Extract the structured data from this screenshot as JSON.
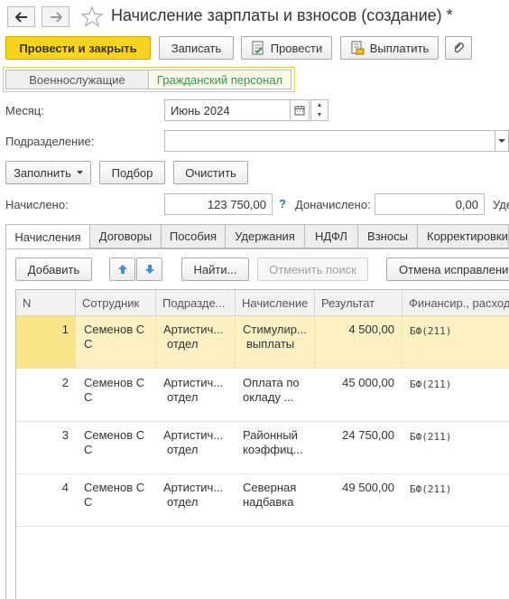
{
  "header": {
    "title": "Начисление зарплаты и взносов (создание) *"
  },
  "toolbar": {
    "post_close": "Провести и закрыть",
    "save": "Записать",
    "post": "Провести",
    "pay": "Выплатить"
  },
  "switcher": {
    "military": "Военнослужащие",
    "civil": "Гражданский персонал"
  },
  "form": {
    "month_label": "Месяц:",
    "month_value": "Июнь 2024",
    "department_label": "Подразделение:",
    "department_value": "",
    "fill_btn": "Заполнить",
    "select_btn": "Подбор",
    "clear_btn": "Очистить",
    "accrued_label": "Начислено:",
    "accrued_value": "123 750,00",
    "help_mark": "?",
    "additional_label": "Доначислено:",
    "additional_value": "0,00",
    "withheld_label": "Уде"
  },
  "tabs": [
    {
      "label": "Начисления"
    },
    {
      "label": "Договоры"
    },
    {
      "label": "Пособия"
    },
    {
      "label": "Удержания"
    },
    {
      "label": "НДФЛ"
    },
    {
      "label": "Взносы"
    },
    {
      "label": "Корректировки"
    }
  ],
  "table_toolbar": {
    "add": "Добавить",
    "find": "Найти...",
    "cancel_search": "Отменить поиск",
    "cancel_fix": "Отмена исправлений"
  },
  "table": {
    "columns": [
      "N",
      "Сотрудник",
      "Подразде...",
      "Начисление",
      "Результат",
      "Финансир., расход"
    ],
    "rows": [
      {
        "n": "1",
        "employee": [
          "Семенов С",
          "С"
        ],
        "dept": [
          "Артистич...",
          "отдел"
        ],
        "accrual": [
          "Стимулир...",
          "выплаты"
        ],
        "result": "4 500,00",
        "finance": "БФ(211)"
      },
      {
        "n": "2",
        "employee": [
          "Семенов С",
          "С"
        ],
        "dept": [
          "Артистич...",
          "отдел"
        ],
        "accrual": [
          "Оплата по",
          "окладу ..."
        ],
        "result": "45 000,00",
        "finance": "БФ(211)"
      },
      {
        "n": "3",
        "employee": [
          "Семенов С",
          "С"
        ],
        "dept": [
          "Артистич...",
          "отдел"
        ],
        "accrual": [
          "Районный",
          "коэффиц..."
        ],
        "result": "24 750,00",
        "finance": "БФ(211)"
      },
      {
        "n": "4",
        "employee": [
          "Семенов С",
          "С"
        ],
        "dept": [
          "Артистич...",
          "отдел"
        ],
        "accrual": [
          "Северная",
          "надбавка"
        ],
        "result": "49 500,00",
        "finance": "БФ(211)"
      }
    ]
  },
  "colors": {
    "primary": "#f9d41d",
    "selected_row": "#fbf0c2",
    "active_switch_text": "#2e9a47",
    "link_blue": "#2e6fc2"
  }
}
